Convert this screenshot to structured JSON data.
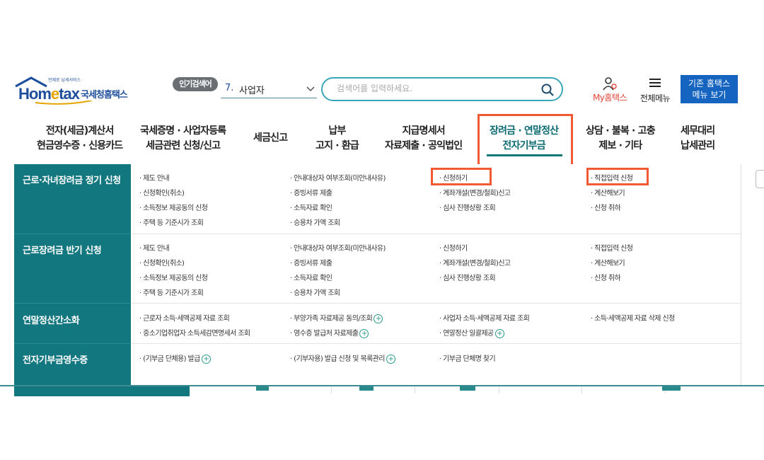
{
  "logo": {
    "word_pre": "Hom",
    "word_e": "e",
    "word_post": "tax",
    "tagline": "언제로 납세서비스",
    "korean": "국세청홈택스"
  },
  "popular": {
    "badge": "인기검색어",
    "number": "7.",
    "term": "사업자"
  },
  "search": {
    "placeholder": "검색어를 입력하세요."
  },
  "utility": {
    "my_label": "My홈택스",
    "all_menu_label": "전체메뉴",
    "legacy_line1": "기존 홈택스",
    "legacy_line2": "메뉴 보기"
  },
  "gnb": [
    {
      "line1": "전자(세금)계산서",
      "line2": "현금영수증 · 신용카드"
    },
    {
      "line1": "국세증명 · 사업자등록",
      "line2": "세금관련 신청/신고"
    },
    {
      "line1": "세금신고",
      "line2": ""
    },
    {
      "line1": "납부",
      "line2": "고지 · 환급"
    },
    {
      "line1": "지급명세서",
      "line2": "자료제출 · 공익법인"
    },
    {
      "line1": "장려금 · 연말정산",
      "line2": "전자기부금"
    },
    {
      "line1": "상담 · 불복 · 고충",
      "line2": "제보 · 기타"
    },
    {
      "line1": "세무대리",
      "line2": "납세관리"
    }
  ],
  "sections": [
    {
      "title": "근로·자녀장려금 정기 신청",
      "links": [
        [
          "· 제도 안내",
          "· 신청확인(취소)",
          "· 소득정보 제공동의 신청",
          "· 주택 등 기준시가 조회"
        ],
        [
          "· 안내대상자 여부조회(미안내사유)",
          "· 증빙서류 제출",
          "· 소득자료 확인",
          "· 승용차 가액 조회"
        ],
        [
          "· 신청하기",
          "· 계좌개설(변경/철회)신고",
          "· 심사 진행상황 조회"
        ],
        [
          "· 직접입력 신청",
          "· 계산해보기",
          "· 신청 취하"
        ]
      ]
    },
    {
      "title": "근로장려금 반기 신청",
      "links": [
        [
          "· 제도 안내",
          "· 신청확인(취소)",
          "· 소득정보 제공동의 신청",
          "· 주택 등 기준시가 조회"
        ],
        [
          "· 안내대상자 여부조회(미안내사유)",
          "· 증빙서류 제출",
          "· 소득자료 확인",
          "· 승용차 가액 조회"
        ],
        [
          "· 신청하기",
          "· 계좌개설(변경/철회)신고",
          "· 심사 진행상황 조회"
        ],
        [
          "· 직접입력 신청",
          "· 계산해보기",
          "· 신청 취하"
        ]
      ]
    },
    {
      "title": "연말정산간소화",
      "links": [
        [
          "· 근로자 소득·세액공제 자료 조회",
          "· 중소기업취업자 소득세감면명세서 조회"
        ],
        [
          "· 부양가족 자료제공 동의/조회",
          "· 영수증 발급처 자료제출"
        ],
        [
          "· 사업자 소득·세액공제 자료 조회",
          "· 연말정산 일괄제공"
        ],
        [
          "· 소득·세액공제 자료 삭제 신청"
        ]
      ]
    },
    {
      "title": "전자기부금영수증",
      "links": [
        [
          "· (기부금 단체용) 발급"
        ],
        [
          "· (기부자용) 발급 신청 및 목록관리"
        ],
        [
          "· 기부금 단체명 찾기"
        ],
        []
      ]
    }
  ],
  "colors": {
    "accent": "#137780",
    "highlight": "#f25a34",
    "brand_blue": "#1565c0",
    "my_red": "#e0463a"
  }
}
